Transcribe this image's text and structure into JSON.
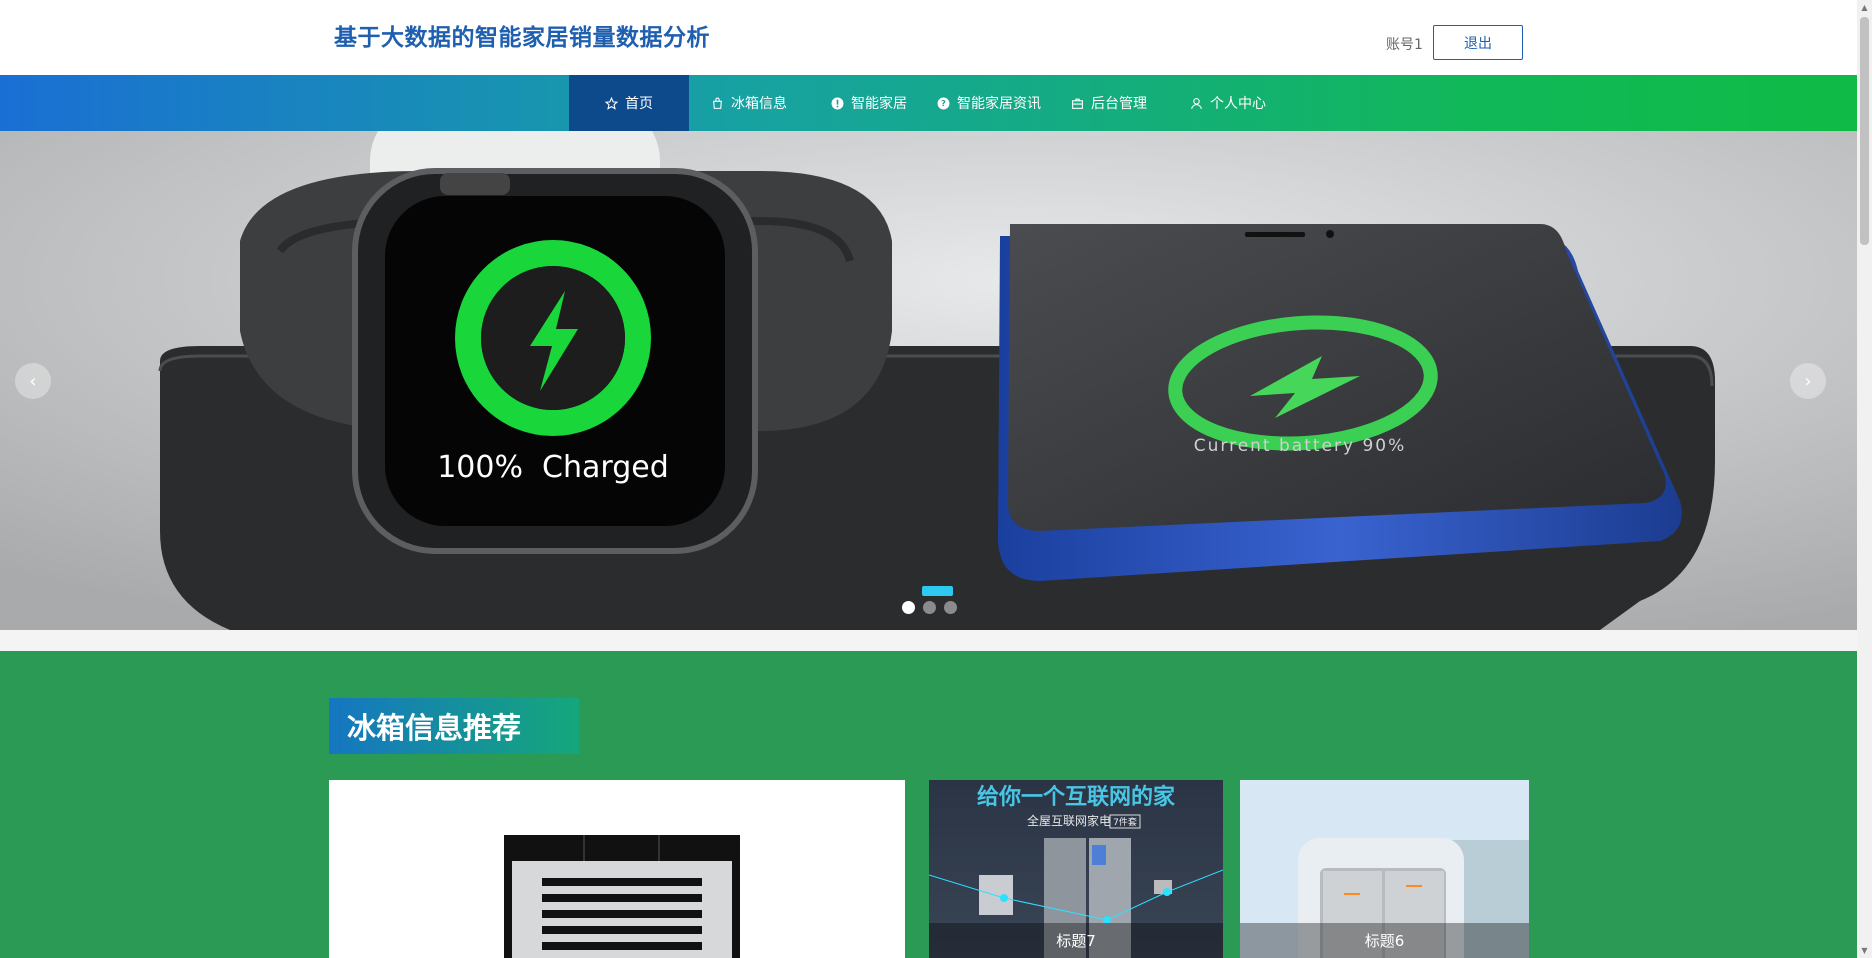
{
  "header": {
    "title": "基于大数据的智能家居销量数据分析",
    "account": "账号1",
    "logout_label": "退出"
  },
  "nav": {
    "items": [
      {
        "label": "首页",
        "icon": "star-icon"
      },
      {
        "label": "冰箱信息",
        "icon": "bag-icon"
      },
      {
        "label": "智能家居",
        "icon": "info-icon"
      },
      {
        "label": "智能家居资讯",
        "icon": "question-icon"
      },
      {
        "label": "后台管理",
        "icon": "briefcase-icon"
      },
      {
        "label": "个人中心",
        "icon": "user-icon"
      }
    ]
  },
  "banner": {
    "watch_text": "100%  Charged",
    "phone_text": "Current battery 90%",
    "prev_icon": "chevron-left-icon",
    "next_icon": "chevron-right-icon",
    "dots_count": 3
  },
  "section": {
    "title": "冰箱信息推荐",
    "cards": [
      {
        "caption": ""
      },
      {
        "caption": "标题7",
        "headline": "给你一个互联网的家",
        "subline": "全屋互联网家电",
        "badge": "7件套"
      },
      {
        "caption": "标题6"
      }
    ]
  },
  "colors": {
    "brand_blue": "#1f5fb0",
    "nav_active": "#0d4a8c",
    "section_green": "#2a9a54",
    "charge_green": "#19d63a"
  }
}
